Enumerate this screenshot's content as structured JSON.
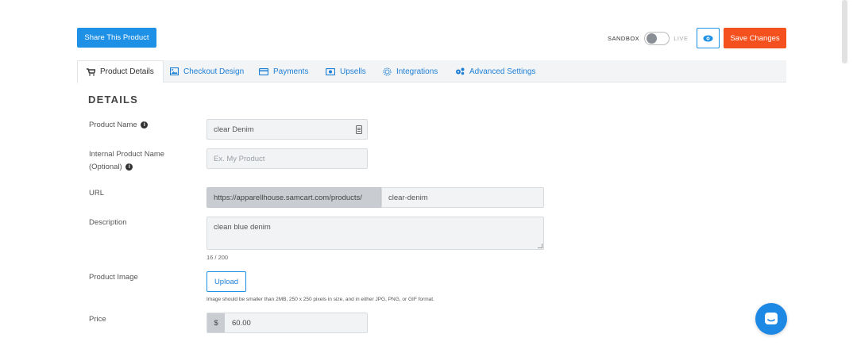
{
  "header": {
    "share_label": "Share This Product",
    "sandbox_label": "SANDBOX",
    "live_label": "LIVE",
    "save_label": "Save Changes"
  },
  "tabs": [
    {
      "label": "Product Details",
      "icon": "cart-icon",
      "active": true
    },
    {
      "label": "Checkout Design",
      "icon": "image-icon"
    },
    {
      "label": "Payments",
      "icon": "credit-card-icon"
    },
    {
      "label": "Upsells",
      "icon": "upsell-icon"
    },
    {
      "label": "Integrations",
      "icon": "integrations-icon"
    },
    {
      "label": "Advanced Settings",
      "icon": "cogs-icon"
    }
  ],
  "details": {
    "title": "DETAILS",
    "product_name_label": "Product Name",
    "product_name_value": "clear Denim",
    "internal_name_label_1": "Internal Product Name",
    "internal_name_label_2": "(Optional)",
    "internal_name_placeholder": "Ex. My Product",
    "url_label": "URL",
    "url_prefix": "https://apparellhouse.samcart.com/products/",
    "url_slug": "clear-denim",
    "description_label": "Description",
    "description_value": "clean blue denim",
    "description_counter": "16 / 200",
    "image_label": "Product Image",
    "upload_label": "Upload",
    "image_hint": "Image should be smaller than 2MB, 250 x 250 pixels in size, and in either JPG, PNG, or GIF format.",
    "price_label": "Price",
    "price_currency": "$",
    "price_value": "60.00"
  },
  "colors": {
    "primary": "#1e90e6",
    "save": "#f4511e"
  }
}
